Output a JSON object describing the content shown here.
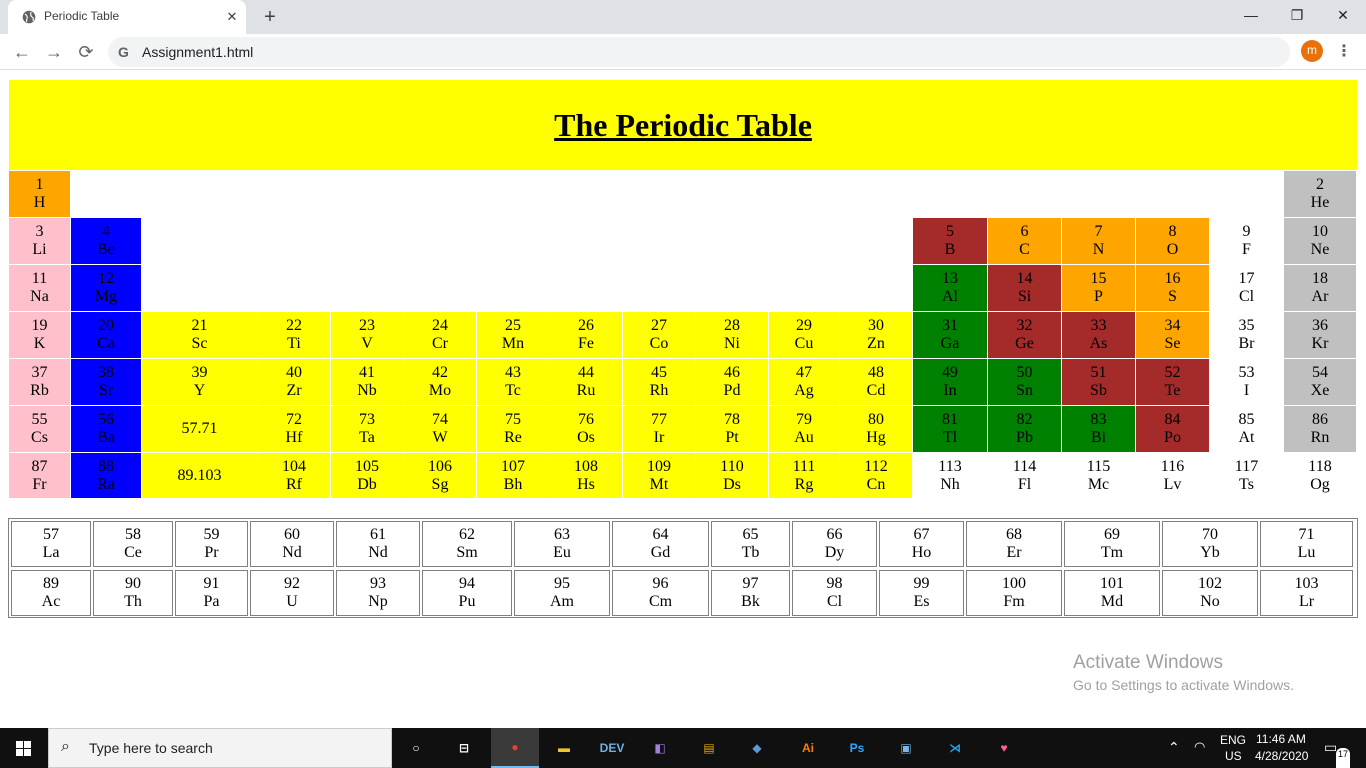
{
  "browser": {
    "tab_title": "Periodic Table",
    "tab_close": "✕",
    "new_tab": "+",
    "window_controls": [
      "—",
      "❐",
      "✕"
    ],
    "nav": {
      "back": "←",
      "forward": "→",
      "reload": "⟳"
    },
    "address": "Assignment1.html",
    "profile_initial": "m",
    "menu": "⋮"
  },
  "page": {
    "title": "The Periodic Table",
    "colors": {
      "orange": "#ffa500",
      "pink": "#ffc0cb",
      "blue": "#0000ff",
      "yellow": "#ffff00",
      "brown": "#a52a2a",
      "green": "#008000",
      "gray": "#c0c0c0",
      "white": "#ffffff"
    },
    "main_table": [
      {
        "n": "1",
        "s": "H",
        "row": 1,
        "col": 1,
        "color": "orange"
      },
      {
        "n": "2",
        "s": "He",
        "row": 1,
        "col": 18,
        "color": "gray"
      },
      {
        "n": "3",
        "s": "Li",
        "row": 2,
        "col": 1,
        "color": "pink"
      },
      {
        "n": "4",
        "s": "Be",
        "row": 2,
        "col": 2,
        "color": "blue"
      },
      {
        "n": "5",
        "s": "B",
        "row": 2,
        "col": 13,
        "color": "brown"
      },
      {
        "n": "6",
        "s": "C",
        "row": 2,
        "col": 14,
        "color": "orange"
      },
      {
        "n": "7",
        "s": "N",
        "row": 2,
        "col": 15,
        "color": "orange"
      },
      {
        "n": "8",
        "s": "O",
        "row": 2,
        "col": 16,
        "color": "orange"
      },
      {
        "n": "9",
        "s": "F",
        "row": 2,
        "col": 17,
        "color": "white"
      },
      {
        "n": "10",
        "s": "Ne",
        "row": 2,
        "col": 18,
        "color": "gray"
      },
      {
        "n": "11",
        "s": "Na",
        "row": 3,
        "col": 1,
        "color": "pink"
      },
      {
        "n": "12",
        "s": "Mg",
        "row": 3,
        "col": 2,
        "color": "blue"
      },
      {
        "n": "13",
        "s": "Al",
        "row": 3,
        "col": 13,
        "color": "green"
      },
      {
        "n": "14",
        "s": "Si",
        "row": 3,
        "col": 14,
        "color": "brown"
      },
      {
        "n": "15",
        "s": "P",
        "row": 3,
        "col": 15,
        "color": "orange"
      },
      {
        "n": "16",
        "s": "S",
        "row": 3,
        "col": 16,
        "color": "orange"
      },
      {
        "n": "17",
        "s": "Cl",
        "row": 3,
        "col": 17,
        "color": "white"
      },
      {
        "n": "18",
        "s": "Ar",
        "row": 3,
        "col": 18,
        "color": "gray"
      },
      {
        "n": "19",
        "s": "K",
        "row": 4,
        "col": 1,
        "color": "pink"
      },
      {
        "n": "20",
        "s": "Ca",
        "row": 4,
        "col": 2,
        "color": "blue"
      },
      {
        "n": "21",
        "s": "Sc",
        "row": 4,
        "col": 3,
        "color": "yellow"
      },
      {
        "n": "22",
        "s": "Ti",
        "row": 4,
        "col": 4,
        "color": "yellow"
      },
      {
        "n": "23",
        "s": "V",
        "row": 4,
        "col": 5,
        "color": "yellow"
      },
      {
        "n": "24",
        "s": "Cr",
        "row": 4,
        "col": 6,
        "color": "yellow"
      },
      {
        "n": "25",
        "s": "Mn",
        "row": 4,
        "col": 7,
        "color": "yellow"
      },
      {
        "n": "26",
        "s": "Fe",
        "row": 4,
        "col": 8,
        "color": "yellow"
      },
      {
        "n": "27",
        "s": "Co",
        "row": 4,
        "col": 9,
        "color": "yellow"
      },
      {
        "n": "28",
        "s": "Ni",
        "row": 4,
        "col": 10,
        "color": "yellow"
      },
      {
        "n": "29",
        "s": "Cu",
        "row": 4,
        "col": 11,
        "color": "yellow"
      },
      {
        "n": "30",
        "s": "Zn",
        "row": 4,
        "col": 12,
        "color": "yellow"
      },
      {
        "n": "31",
        "s": "Ga",
        "row": 4,
        "col": 13,
        "color": "green"
      },
      {
        "n": "32",
        "s": "Ge",
        "row": 4,
        "col": 14,
        "color": "brown"
      },
      {
        "n": "33",
        "s": "As",
        "row": 4,
        "col": 15,
        "color": "brown"
      },
      {
        "n": "34",
        "s": "Se",
        "row": 4,
        "col": 16,
        "color": "orange"
      },
      {
        "n": "35",
        "s": "Br",
        "row": 4,
        "col": 17,
        "color": "white"
      },
      {
        "n": "36",
        "s": "Kr",
        "row": 4,
        "col": 18,
        "color": "gray"
      },
      {
        "n": "37",
        "s": "Rb",
        "row": 5,
        "col": 1,
        "color": "pink"
      },
      {
        "n": "38",
        "s": "Sr",
        "row": 5,
        "col": 2,
        "color": "blue"
      },
      {
        "n": "39",
        "s": "Y",
        "row": 5,
        "col": 3,
        "color": "yellow"
      },
      {
        "n": "40",
        "s": "Zr",
        "row": 5,
        "col": 4,
        "color": "yellow"
      },
      {
        "n": "41",
        "s": "Nb",
        "row": 5,
        "col": 5,
        "color": "yellow"
      },
      {
        "n": "42",
        "s": "Mo",
        "row": 5,
        "col": 6,
        "color": "yellow"
      },
      {
        "n": "43",
        "s": "Tc",
        "row": 5,
        "col": 7,
        "color": "yellow"
      },
      {
        "n": "44",
        "s": "Ru",
        "row": 5,
        "col": 8,
        "color": "yellow"
      },
      {
        "n": "45",
        "s": "Rh",
        "row": 5,
        "col": 9,
        "color": "yellow"
      },
      {
        "n": "46",
        "s": "Pd",
        "row": 5,
        "col": 10,
        "color": "yellow"
      },
      {
        "n": "47",
        "s": "Ag",
        "row": 5,
        "col": 11,
        "color": "yellow"
      },
      {
        "n": "48",
        "s": "Cd",
        "row": 5,
        "col": 12,
        "color": "yellow"
      },
      {
        "n": "49",
        "s": "In",
        "row": 5,
        "col": 13,
        "color": "green"
      },
      {
        "n": "50",
        "s": "Sn",
        "row": 5,
        "col": 14,
        "color": "green"
      },
      {
        "n": "51",
        "s": "Sb",
        "row": 5,
        "col": 15,
        "color": "brown"
      },
      {
        "n": "52",
        "s": "Te",
        "row": 5,
        "col": 16,
        "color": "brown"
      },
      {
        "n": "53",
        "s": "I",
        "row": 5,
        "col": 17,
        "color": "white"
      },
      {
        "n": "54",
        "s": "Xe",
        "row": 5,
        "col": 18,
        "color": "gray"
      },
      {
        "n": "55",
        "s": "Cs",
        "row": 6,
        "col": 1,
        "color": "pink"
      },
      {
        "n": "56",
        "s": "Ba",
        "row": 6,
        "col": 2,
        "color": "blue"
      },
      {
        "n": "57.71",
        "s": "",
        "row": 6,
        "col": 3,
        "color": "yellow"
      },
      {
        "n": "72",
        "s": "Hf",
        "row": 6,
        "col": 4,
        "color": "yellow"
      },
      {
        "n": "73",
        "s": "Ta",
        "row": 6,
        "col": 5,
        "color": "yellow"
      },
      {
        "n": "74",
        "s": "W",
        "row": 6,
        "col": 6,
        "color": "yellow"
      },
      {
        "n": "75",
        "s": "Re",
        "row": 6,
        "col": 7,
        "color": "yellow"
      },
      {
        "n": "76",
        "s": "Os",
        "row": 6,
        "col": 8,
        "color": "yellow"
      },
      {
        "n": "77",
        "s": "Ir",
        "row": 6,
        "col": 9,
        "color": "yellow"
      },
      {
        "n": "78",
        "s": "Pt",
        "row": 6,
        "col": 10,
        "color": "yellow"
      },
      {
        "n": "79",
        "s": "Au",
        "row": 6,
        "col": 11,
        "color": "yellow"
      },
      {
        "n": "80",
        "s": "Hg",
        "row": 6,
        "col": 12,
        "color": "yellow"
      },
      {
        "n": "81",
        "s": "Tl",
        "row": 6,
        "col": 13,
        "color": "green"
      },
      {
        "n": "82",
        "s": "Pb",
        "row": 6,
        "col": 14,
        "color": "green"
      },
      {
        "n": "83",
        "s": "Bi",
        "row": 6,
        "col": 15,
        "color": "green"
      },
      {
        "n": "84",
        "s": "Po",
        "row": 6,
        "col": 16,
        "color": "brown"
      },
      {
        "n": "85",
        "s": "At",
        "row": 6,
        "col": 17,
        "color": "white"
      },
      {
        "n": "86",
        "s": "Rn",
        "row": 6,
        "col": 18,
        "color": "gray"
      },
      {
        "n": "87",
        "s": "Fr",
        "row": 7,
        "col": 1,
        "color": "pink"
      },
      {
        "n": "88",
        "s": "Ra",
        "row": 7,
        "col": 2,
        "color": "blue"
      },
      {
        "n": "89.103",
        "s": "",
        "row": 7,
        "col": 3,
        "color": "yellow"
      },
      {
        "n": "104",
        "s": "Rf",
        "row": 7,
        "col": 4,
        "color": "yellow"
      },
      {
        "n": "105",
        "s": "Db",
        "row": 7,
        "col": 5,
        "color": "yellow"
      },
      {
        "n": "106",
        "s": "Sg",
        "row": 7,
        "col": 6,
        "color": "yellow"
      },
      {
        "n": "107",
        "s": "Bh",
        "row": 7,
        "col": 7,
        "color": "yellow"
      },
      {
        "n": "108",
        "s": "Hs",
        "row": 7,
        "col": 8,
        "color": "yellow"
      },
      {
        "n": "109",
        "s": "Mt",
        "row": 7,
        "col": 9,
        "color": "yellow"
      },
      {
        "n": "110",
        "s": "Ds",
        "row": 7,
        "col": 10,
        "color": "yellow"
      },
      {
        "n": "111",
        "s": "Rg",
        "row": 7,
        "col": 11,
        "color": "yellow"
      },
      {
        "n": "112",
        "s": "Cn",
        "row": 7,
        "col": 12,
        "color": "yellow"
      },
      {
        "n": "113",
        "s": "Nh",
        "row": 7,
        "col": 13,
        "color": "white"
      },
      {
        "n": "114",
        "s": "Fl",
        "row": 7,
        "col": 14,
        "color": "white"
      },
      {
        "n": "115",
        "s": "Mc",
        "row": 7,
        "col": 15,
        "color": "white"
      },
      {
        "n": "116",
        "s": "Lv",
        "row": 7,
        "col": 16,
        "color": "white"
      },
      {
        "n": "117",
        "s": "Ts",
        "row": 7,
        "col": 17,
        "color": "white"
      },
      {
        "n": "118",
        "s": "Og",
        "row": 7,
        "col": 18,
        "color": "white"
      }
    ],
    "lanthanides": [
      {
        "n": "57",
        "s": "La"
      },
      {
        "n": "58",
        "s": "Ce"
      },
      {
        "n": "59",
        "s": "Pr"
      },
      {
        "n": "60",
        "s": "Nd"
      },
      {
        "n": "61",
        "s": "Nd"
      },
      {
        "n": "62",
        "s": "Sm"
      },
      {
        "n": "63",
        "s": "Eu"
      },
      {
        "n": "64",
        "s": "Gd"
      },
      {
        "n": "65",
        "s": "Tb"
      },
      {
        "n": "66",
        "s": "Dy"
      },
      {
        "n": "67",
        "s": "Ho"
      },
      {
        "n": "68",
        "s": "Er"
      },
      {
        "n": "69",
        "s": "Tm"
      },
      {
        "n": "70",
        "s": "Yb"
      },
      {
        "n": "71",
        "s": "Lu"
      }
    ],
    "actinides": [
      {
        "n": "89",
        "s": "Ac"
      },
      {
        "n": "90",
        "s": "Th"
      },
      {
        "n": "91",
        "s": "Pa"
      },
      {
        "n": "92",
        "s": "U"
      },
      {
        "n": "93",
        "s": "Np"
      },
      {
        "n": "94",
        "s": "Pu"
      },
      {
        "n": "95",
        "s": "Am"
      },
      {
        "n": "96",
        "s": "Cm"
      },
      {
        "n": "97",
        "s": "Bk"
      },
      {
        "n": "98",
        "s": "Cl"
      },
      {
        "n": "99",
        "s": "Es"
      },
      {
        "n": "100",
        "s": "Fm"
      },
      {
        "n": "101",
        "s": "Md"
      },
      {
        "n": "102",
        "s": "No"
      },
      {
        "n": "103",
        "s": "Lr"
      }
    ],
    "watermark": {
      "line1": "Activate Windows",
      "line2": "Go to Settings to activate Windows."
    }
  },
  "taskbar": {
    "search_placeholder": "Type here to search",
    "icons": [
      {
        "name": "cortana-icon",
        "glyph": "○"
      },
      {
        "name": "task-view-icon",
        "glyph": "⊟"
      },
      {
        "name": "chrome-icon",
        "glyph": "●"
      },
      {
        "name": "file-explorer-icon",
        "glyph": "▬"
      },
      {
        "name": "devcpp-icon",
        "glyph": "DEV"
      },
      {
        "name": "visual-studio-icon",
        "glyph": "◧"
      },
      {
        "name": "file-app-icon",
        "glyph": "▤"
      },
      {
        "name": "app-icon",
        "glyph": "◆"
      },
      {
        "name": "illustrator-icon",
        "glyph": "Ai"
      },
      {
        "name": "photoshop-icon",
        "glyph": "Ps"
      },
      {
        "name": "cube-app-icon",
        "glyph": "▣"
      },
      {
        "name": "vscode-icon",
        "glyph": "⋊"
      },
      {
        "name": "heart-app-icon",
        "glyph": "♥"
      }
    ],
    "language_top": "ENG",
    "language_bottom": "US",
    "time": "11:46 AM",
    "date": "4/28/2020",
    "notification_count": "17"
  }
}
